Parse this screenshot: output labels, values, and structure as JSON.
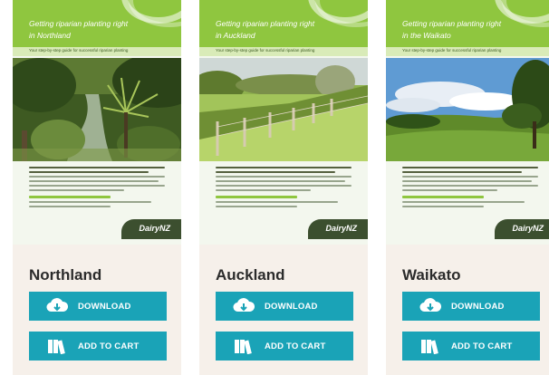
{
  "colors": {
    "header_green": "#8fc63f",
    "button_teal": "#1aa3b7",
    "card_bg": "#f6f0ea",
    "logo_bg": "#3c4f2f"
  },
  "cards": [
    {
      "brochure": {
        "title_line1": "Getting riparian planting right",
        "title_line2": "in Northland",
        "subtitle": "Your step-by-step guide for successful riparian planting",
        "logo": "DairyNZ"
      },
      "region": "Northland",
      "download_label": "DOWNLOAD",
      "download_icon": "download-icon",
      "cart_label": "ADD TO CART",
      "cart_icon": "books-icon"
    },
    {
      "brochure": {
        "title_line1": "Getting riparian planting right",
        "title_line2": "in Auckland",
        "subtitle": "Your step-by-step guide for successful riparian planting",
        "logo": "DairyNZ"
      },
      "region": "Auckland",
      "download_label": "DOWNLOAD",
      "download_icon": "download-icon",
      "cart_label": "ADD TO CART",
      "cart_icon": "books-icon"
    },
    {
      "brochure": {
        "title_line1": "Getting riparian planting right",
        "title_line2": "in the Waikato",
        "subtitle": "Your step-by-step guide for successful riparian planting",
        "logo": "DairyNZ"
      },
      "region": "Waikato",
      "download_label": "DOWNLOAD",
      "download_icon": "download-icon",
      "cart_label": "ADD TO CART",
      "cart_icon": "books-icon"
    }
  ]
}
